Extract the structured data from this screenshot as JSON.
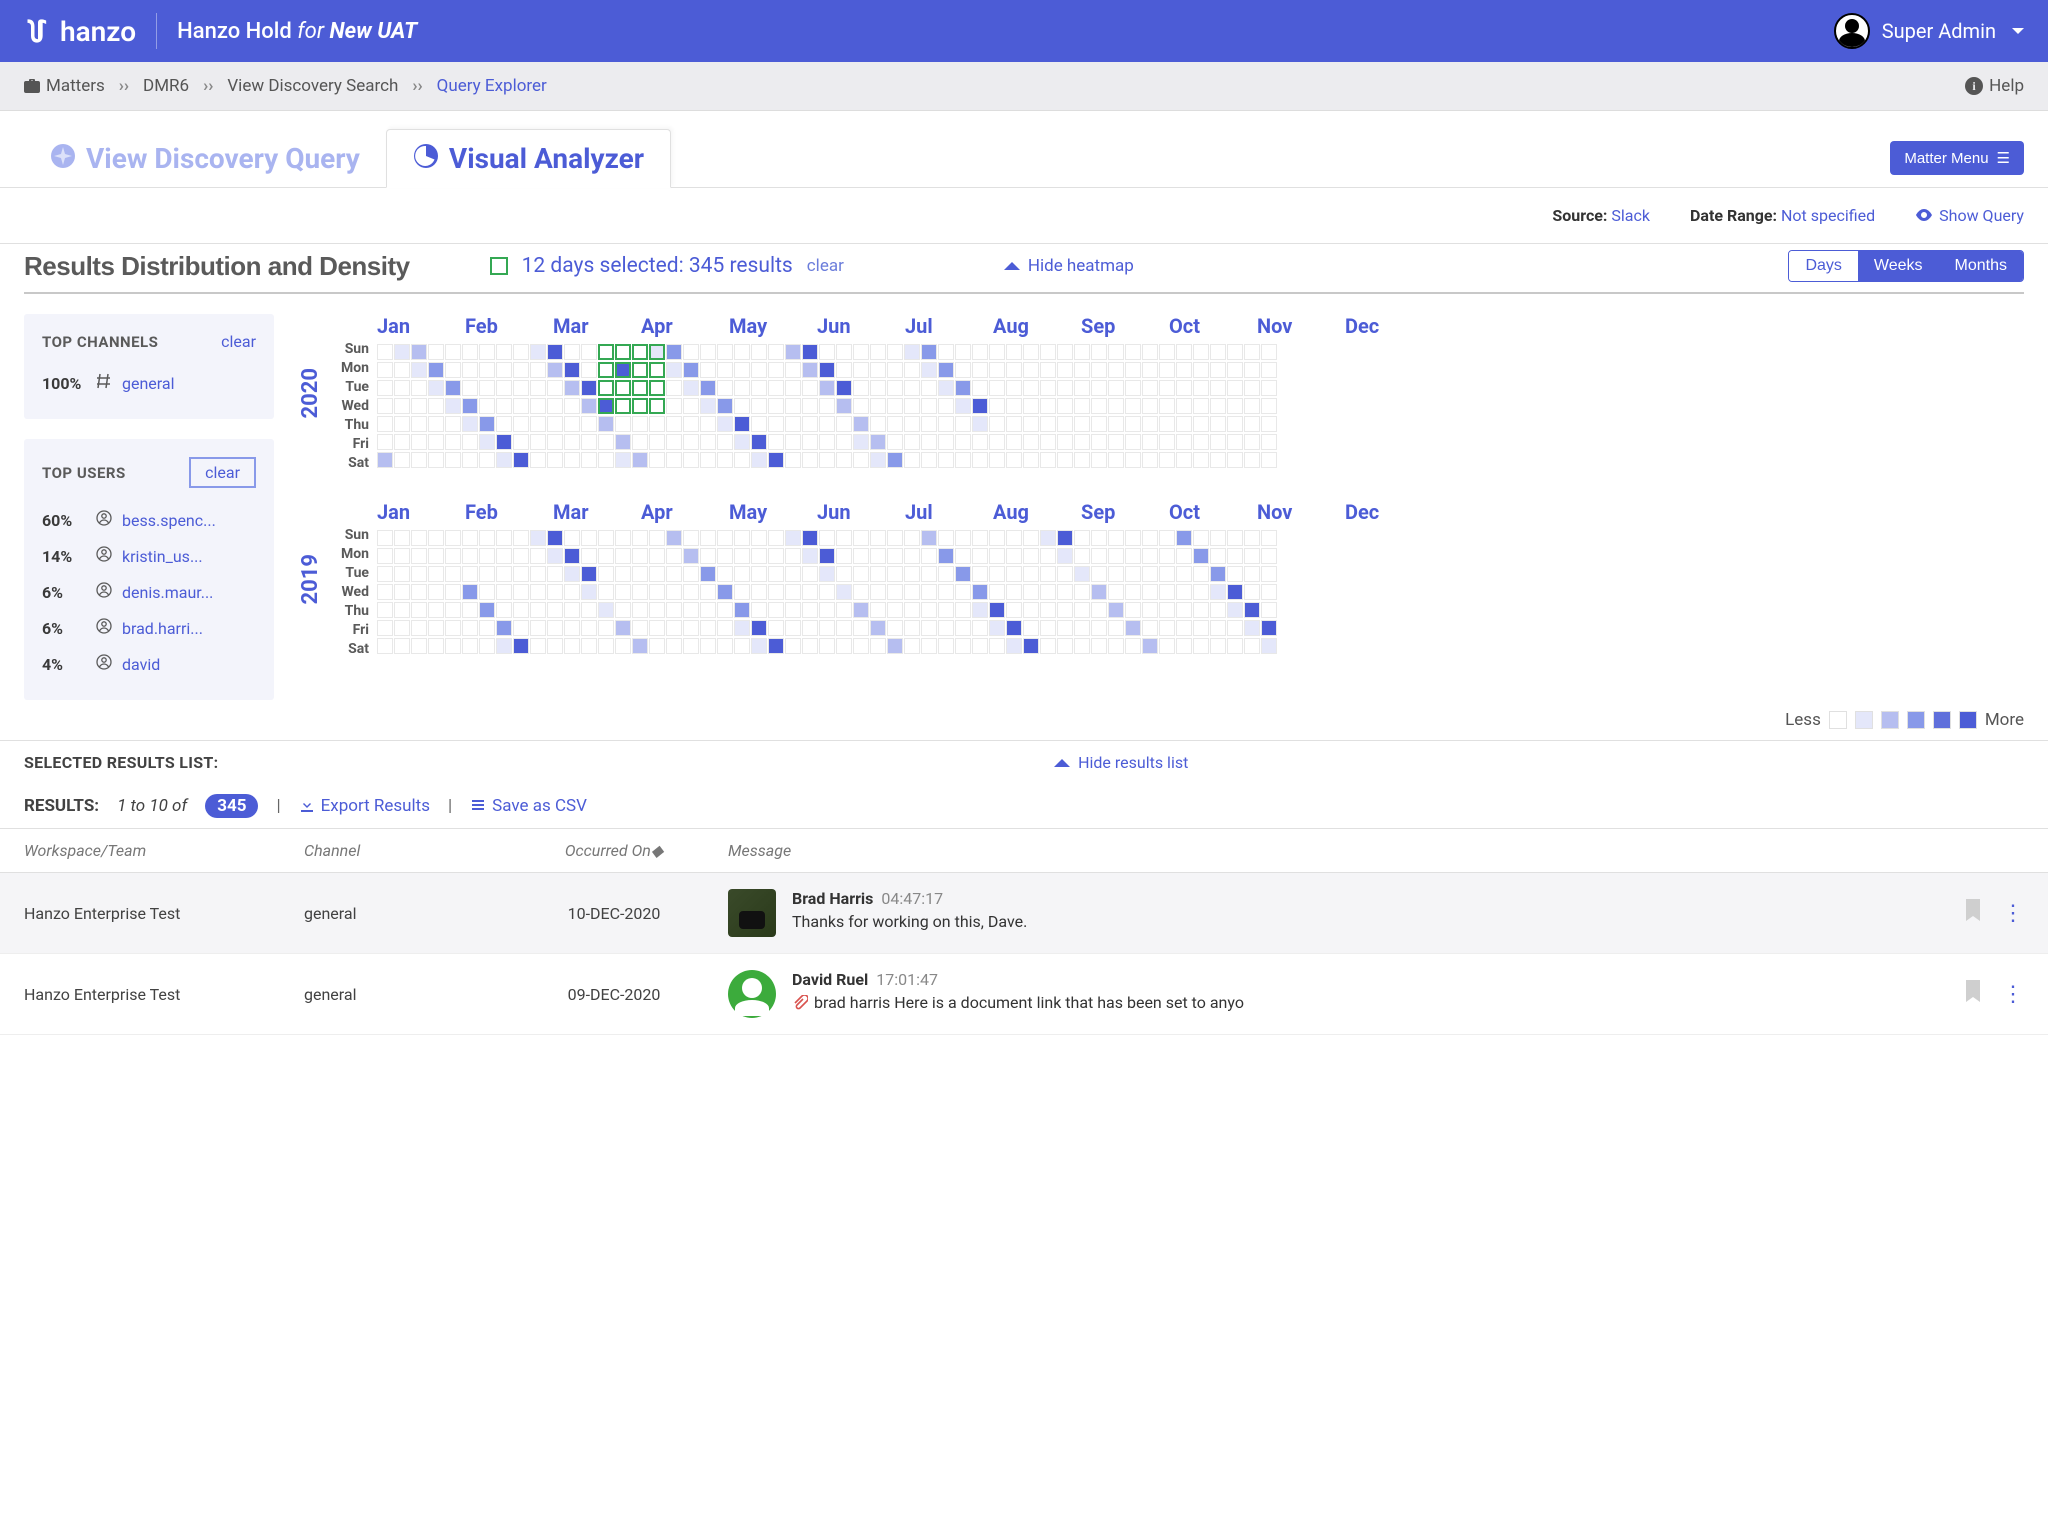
{
  "brand": "hanzo",
  "hold": {
    "prefix": "Hanzo Hold",
    "for": "for",
    "name": "New UAT"
  },
  "user": {
    "name": "Super Admin"
  },
  "breadcrumb": {
    "items": [
      "Matters",
      "DMR6",
      "View Discovery Search",
      "Query Explorer"
    ],
    "help": "Help"
  },
  "tabs": {
    "discovery": "View Discovery Query",
    "visual": "Visual Analyzer"
  },
  "matter_menu": "Matter Menu",
  "source": {
    "label": "Source:",
    "value": "Slack",
    "range_label": "Date Range:",
    "range_value": "Not specified",
    "show_query": "Show Query"
  },
  "density": {
    "title": "Results Distribution and Density",
    "selection": "12 days selected: 345 results",
    "clear": "clear",
    "hide_heatmap": "Hide heatmap",
    "toggle": {
      "days": "Days",
      "weeks": "Weeks",
      "months": "Months"
    }
  },
  "months": [
    "Jan",
    "Feb",
    "Mar",
    "Apr",
    "May",
    "Jun",
    "Jul",
    "Aug",
    "Sep",
    "Oct",
    "Nov",
    "Dec"
  ],
  "dows": [
    "Sun",
    "Mon",
    "Tue",
    "Wed",
    "Thu",
    "Fri",
    "Sat"
  ],
  "years": [
    "2020",
    "2019"
  ],
  "legend": {
    "less": "Less",
    "more": "More"
  },
  "top_channels": {
    "title": "TOP CHANNELS",
    "clear": "clear",
    "items": [
      {
        "pct": "100%",
        "name": "general"
      }
    ]
  },
  "top_users": {
    "title": "TOP USERS",
    "clear": "clear",
    "items": [
      {
        "pct": "60%",
        "name": "bess.spenc..."
      },
      {
        "pct": "14%",
        "name": "kristin_us..."
      },
      {
        "pct": "6%",
        "name": "denis.maur..."
      },
      {
        "pct": "6%",
        "name": "brad.harri..."
      },
      {
        "pct": "4%",
        "name": "david"
      }
    ]
  },
  "selected": {
    "title": "SELECTED RESULTS LIST:",
    "hide": "Hide results list"
  },
  "results": {
    "label": "RESULTS:",
    "range": "1 to 10 of",
    "total": "345",
    "export": "Export Results",
    "csv": "Save as CSV"
  },
  "columns": {
    "ws": "Workspace/Team",
    "ch": "Channel",
    "dt": "Occurred On",
    "msg": "Message"
  },
  "rows": [
    {
      "ws": "Hanzo Enterprise Test",
      "ch": "general",
      "dt": "10-DEC-2020",
      "user": "Brad Harris",
      "time": "04:47:17",
      "text": "Thanks for working on this, Dave.",
      "avatar": "photo"
    },
    {
      "ws": "Hanzo Enterprise Test",
      "ch": "general",
      "dt": "09-DEC-2020",
      "user": "David Ruel",
      "time": "17:01:47",
      "text": "brad harris Here is a document link that has been set to anyo",
      "avatar": "green",
      "attach": true
    }
  ],
  "chart_data": {
    "type": "heatmap",
    "title": "Results Distribution and Density",
    "years": [
      {
        "year": 2020,
        "months_shown": [
          "Jan",
          "Feb",
          "Mar",
          "Apr",
          "May",
          "Jun",
          "Jul",
          "Aug",
          "Sep",
          "Oct",
          "Nov",
          "Dec"
        ],
        "rows": [
          "Sun",
          "Mon",
          "Tue",
          "Wed",
          "Thu",
          "Fri",
          "Sat"
        ],
        "selected_region": {
          "note": "green-bordered cells around early April Sun–Wed",
          "result_count": 345,
          "days_selected": 12
        },
        "intensity_grid_sample": "values range 0–5, scattered Jan–Aug with heaviest in late Jan, early Feb, Apr, early Aug"
      },
      {
        "year": 2019,
        "months_shown": [
          "Jan",
          "Feb",
          "Mar",
          "Apr",
          "May",
          "Jun",
          "Jul",
          "Aug",
          "Sep",
          "Oct",
          "Nov",
          "Dec"
        ],
        "rows": [
          "Sun",
          "Mon",
          "Tue",
          "Wed",
          "Thu",
          "Fri",
          "Sat"
        ],
        "intensity_grid_sample": "sparse Jan–Jun, increasing Aug–Dec with strong cells in Aug Fri, Sep Fri, mid-Oct, late Nov"
      }
    ],
    "legend": {
      "min_label": "Less",
      "max_label": "More",
      "levels": [
        0,
        1,
        2,
        3,
        4,
        5
      ]
    }
  }
}
